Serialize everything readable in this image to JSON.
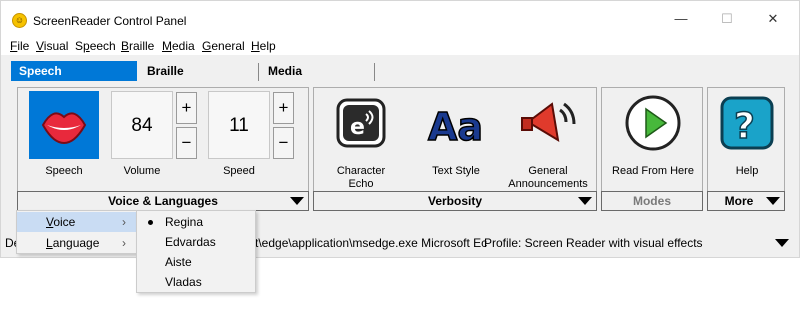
{
  "window": {
    "title": "ScreenReader Control Panel",
    "controls": {
      "minimize": "—",
      "maximize": "☐",
      "close": "✕"
    }
  },
  "menu": [
    {
      "accel": "F",
      "rest": "ile"
    },
    {
      "accel": "V",
      "rest": "isual"
    },
    {
      "accel": "",
      "pre": "S",
      "mid": "p",
      "rest": "eech"
    },
    {
      "accel": "B",
      "rest": "raille"
    },
    {
      "accel": "M",
      "rest": "edia"
    },
    {
      "accel": "G",
      "rest": "eneral"
    },
    {
      "accel": "H",
      "rest": "elp"
    }
  ],
  "tabs": [
    "Speech",
    "Braille",
    "Media"
  ],
  "speech_group": {
    "speech_label": "Speech",
    "volume": {
      "value": "84",
      "label": "Volume"
    },
    "speed": {
      "value": "11",
      "label": "Speed"
    },
    "plus": "+",
    "minus": "−",
    "footer": "Voice & Languages"
  },
  "verbosity_group": {
    "items": [
      {
        "label1": "Character",
        "label2": "Echo"
      },
      {
        "label1": "Text Style",
        "label2": ""
      },
      {
        "label1": "General",
        "label2": "Announcements"
      }
    ],
    "footer": "Verbosity"
  },
  "modes_group": {
    "label": "Read From Here",
    "footer": "Modes"
  },
  "help_group": {
    "label": "Help",
    "footer": "More"
  },
  "status": {
    "left": "De",
    "path": "t\\edge\\application\\msedge.exe Microsoft Ec",
    "profile": "Profile: Screen Reader with visual effects"
  },
  "context_menu": {
    "items": [
      {
        "accel": "V",
        "rest": "oice",
        "highlighted": true
      },
      {
        "accel": "L",
        "rest": "anguage",
        "highlighted": false
      }
    ],
    "chevron": "›"
  },
  "voice_submenu": {
    "items": [
      "Regina",
      "Edvardas",
      "Aiste",
      "Vladas"
    ],
    "selected": "Regina"
  },
  "colors": {
    "accent": "#0078d7",
    "highlight": "#c9dcf3",
    "lips": "#e8293c",
    "play": "#47b83b"
  },
  "icons": {
    "speech": "lips-icon",
    "char_echo": "character-echo-icon",
    "text_style": "text-style-icon",
    "announcements": "megaphone-icon",
    "read": "play-icon",
    "help": "help-icon"
  }
}
